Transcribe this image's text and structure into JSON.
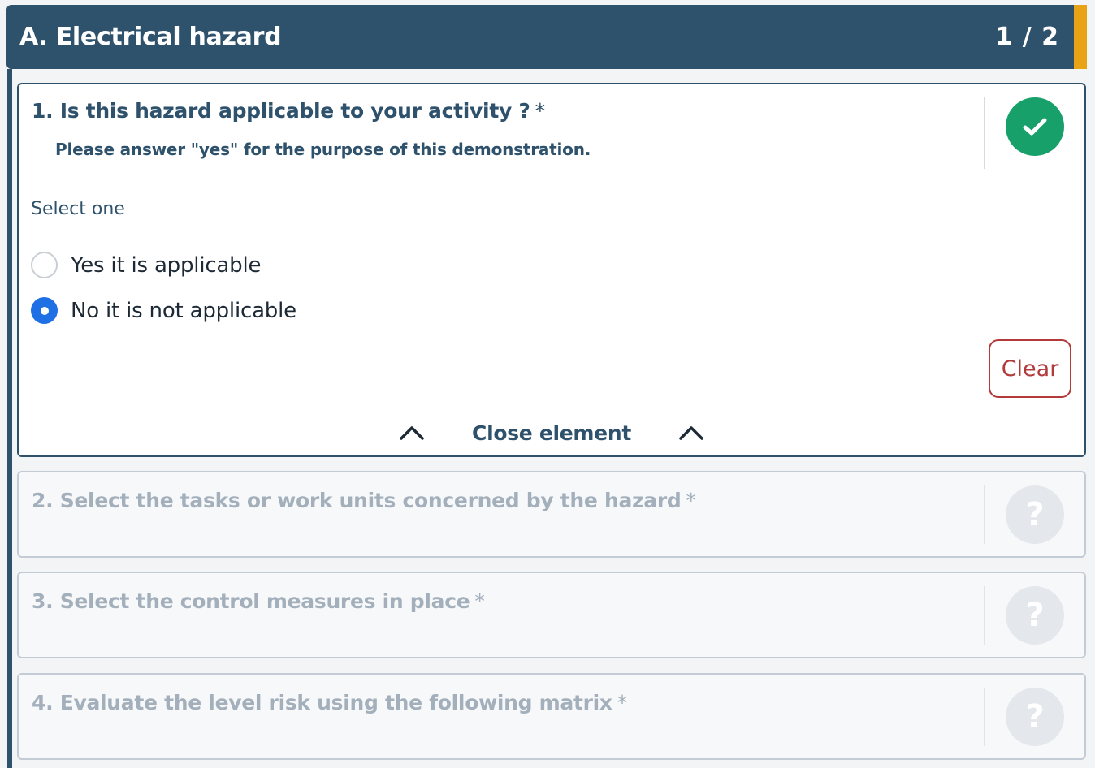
{
  "section": {
    "title": "A. Electrical hazard",
    "counter": "1 / 2"
  },
  "colors": {
    "header": "#2e516c",
    "accent": "#e8a317",
    "success": "#17a06a",
    "radio_selected": "#1f6fe5",
    "clear": "#b23a3a",
    "muted": "#a3afbb"
  },
  "questions": [
    {
      "title": "1. Is this hazard applicable to your activity ?",
      "required_mark": "*",
      "hint": "Please answer \"yes\" for the purpose of this demonstration.",
      "status_icon": "check-icon",
      "select_label": "Select one",
      "options": [
        {
          "label": "Yes it is applicable",
          "selected": false
        },
        {
          "label": "No it is not applicable",
          "selected": true
        }
      ],
      "clear_label": "Clear",
      "close_label": "Close element"
    },
    {
      "title": "2. Select the tasks or work units concerned by the hazard",
      "required_mark": "*",
      "status_icon": "question-icon",
      "status_glyph": "?"
    },
    {
      "title": "3. Select the control measures in place",
      "required_mark": "*",
      "status_icon": "question-icon",
      "status_glyph": "?"
    },
    {
      "title": "4. Evaluate the level risk using the following matrix",
      "required_mark": "*",
      "status_icon": "question-icon",
      "status_glyph": "?"
    }
  ]
}
